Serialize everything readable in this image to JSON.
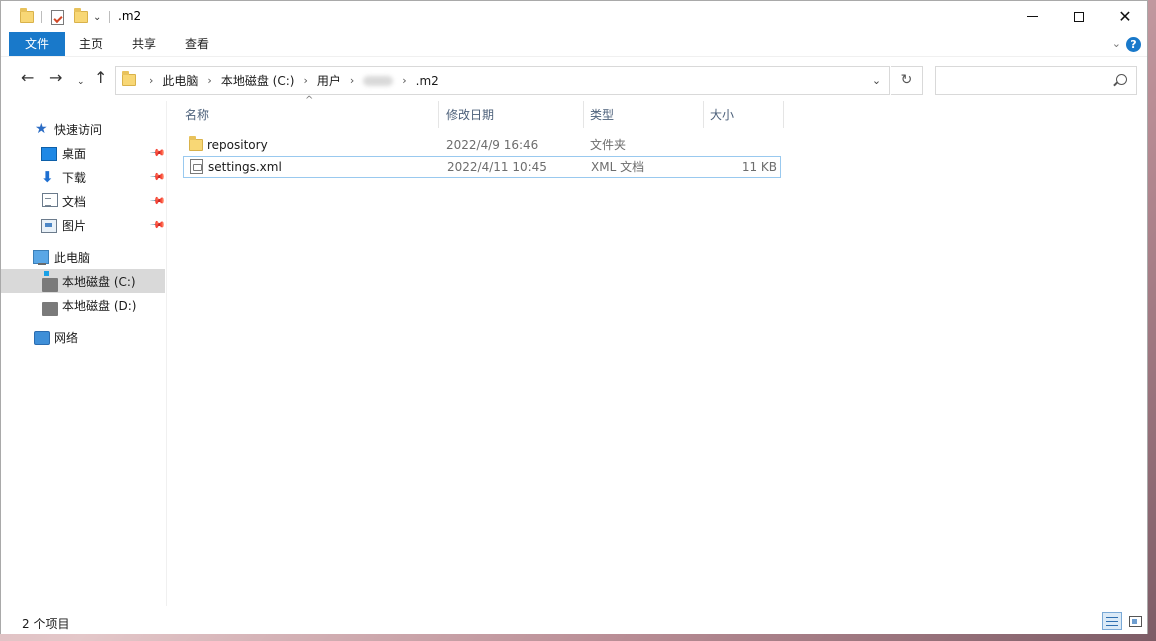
{
  "window": {
    "title": ".m2"
  },
  "ribbon": {
    "tabs": [
      {
        "label": "文件"
      },
      {
        "label": "主页"
      },
      {
        "label": "共享"
      },
      {
        "label": "查看"
      }
    ],
    "expand_glyph": "⌄",
    "help_glyph": "?"
  },
  "titlebar": {
    "minimize_glyph": "",
    "close_glyph": "✕"
  },
  "nav": {
    "back_glyph": "←",
    "forward_glyph": "→",
    "recent_glyph": "⌄",
    "up_glyph": "↑",
    "breadcrumb": [
      "此电脑",
      "本地磁盘 (C:)",
      "用户",
      ".m2"
    ],
    "crumb_separator": "›",
    "dropdown_glyph": "⌄",
    "refresh_glyph": "↻",
    "search": {
      "placeholder": "",
      "value": ""
    }
  },
  "sidebar": {
    "quick_access": {
      "label": "快速访问",
      "icon": "star-icon"
    },
    "pinned": [
      {
        "label": "桌面",
        "icon": "desktop-icon"
      },
      {
        "label": "下载",
        "icon": "download-icon"
      },
      {
        "label": "文档",
        "icon": "documents-icon"
      },
      {
        "label": "图片",
        "icon": "pictures-icon"
      }
    ],
    "pin_glyph": "📌",
    "this_pc": {
      "label": "此电脑",
      "icon": "computer-icon"
    },
    "drives": [
      {
        "label": "本地磁盘 (C:)",
        "selected": true
      },
      {
        "label": "本地磁盘 (D:)",
        "selected": false
      }
    ],
    "network": {
      "label": "网络",
      "icon": "network-icon"
    }
  },
  "file_list": {
    "columns": {
      "name": "名称",
      "date": "修改日期",
      "type": "类型",
      "size": "大小"
    },
    "sort_glyph": "^",
    "rows": [
      {
        "name": "repository",
        "date": "2022/4/9 16:46",
        "type": "文件夹",
        "size": "",
        "icon": "folder-icon"
      },
      {
        "name": "settings.xml",
        "date": "2022/4/11 10:45",
        "type": "XML 文档",
        "size": "11 KB",
        "icon": "xml-file-icon"
      }
    ]
  },
  "status": {
    "item_count": "2 个项目"
  },
  "colors": {
    "accent": "#1979ca",
    "selected_bg": "#d9d9d9",
    "focus_border": "#99c9ef"
  }
}
